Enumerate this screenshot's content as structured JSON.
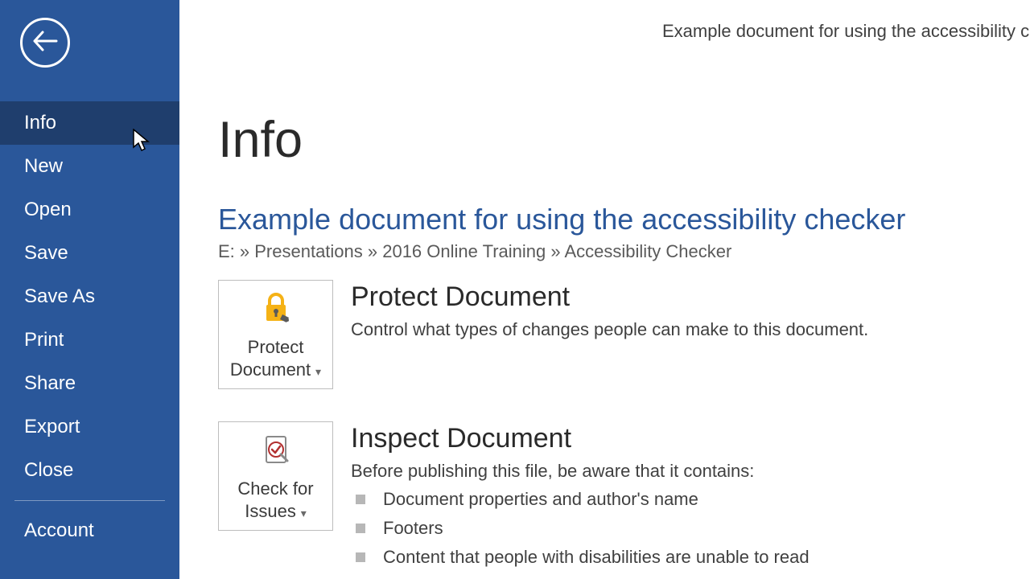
{
  "titleBar": "Example document for using the accessibility checker",
  "sidebar": {
    "items": [
      {
        "label": "Info",
        "active": true
      },
      {
        "label": "New",
        "active": false
      },
      {
        "label": "Open",
        "active": false
      },
      {
        "label": "Save",
        "active": false
      },
      {
        "label": "Save As",
        "active": false
      },
      {
        "label": "Print",
        "active": false
      },
      {
        "label": "Share",
        "active": false
      },
      {
        "label": "Export",
        "active": false
      },
      {
        "label": "Close",
        "active": false
      }
    ],
    "footerItems": [
      {
        "label": "Account"
      }
    ]
  },
  "main": {
    "pageTitle": "Info",
    "docTitle": "Example document for using the accessibility checker",
    "breadcrumb": "E: » Presentations » 2016 Online Training » Accessibility Checker",
    "protect": {
      "buttonLine1": "Protect",
      "buttonLine2": "Document",
      "heading": "Protect Document",
      "desc": "Control what types of changes people can make to this document."
    },
    "inspect": {
      "buttonLine1": "Check for",
      "buttonLine2": "Issues",
      "heading": "Inspect Document",
      "desc": "Before publishing this file, be aware that it contains:",
      "bullets": [
        "Document properties and author's name",
        "Footers",
        "Content that people with disabilities are unable to read"
      ]
    }
  }
}
